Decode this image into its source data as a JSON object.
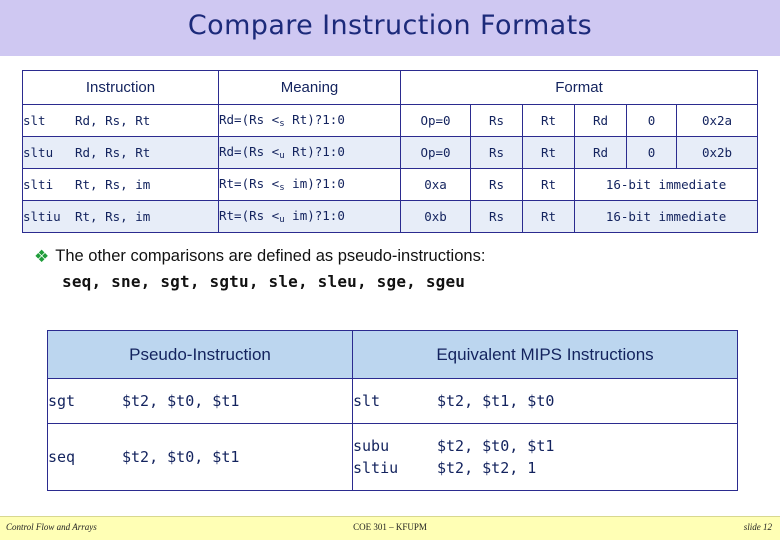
{
  "slide": {
    "title": "Compare Instruction Formats",
    "banner_color": "#cfc8f2",
    "title_color": "#1c2a7a"
  },
  "format_table": {
    "headers": {
      "instruction": "Instruction",
      "meaning": "Meaning",
      "format": "Format"
    },
    "rows": [
      {
        "name": "slt",
        "operands": "Rd, Rs, Rt",
        "meaning_pre": "Rd=(Rs <",
        "meaning_sub": "s",
        "meaning_post": " Rt)?1:0",
        "f1": "Op=0",
        "f2": "Rs",
        "f3": "Rt",
        "f4": "Rd",
        "f5": "0",
        "f6": "0x2a",
        "span_last": false
      },
      {
        "name": "sltu",
        "operands": "Rd, Rs, Rt",
        "meaning_pre": "Rd=(Rs <",
        "meaning_sub": "u",
        "meaning_post": " Rt)?1:0",
        "f1": "Op=0",
        "f2": "Rs",
        "f3": "Rt",
        "f4": "Rd",
        "f5": "0",
        "f6": "0x2b",
        "span_last": false
      },
      {
        "name": "slti",
        "operands": "Rt, Rs, im",
        "meaning_pre": "Rt=(Rs <",
        "meaning_sub": "s",
        "meaning_post": " im)?1:0",
        "f1": "0xa",
        "f2": "Rs",
        "f3": "Rt",
        "f4": "16-bit immediate",
        "f5": "",
        "f6": "",
        "span_last": true
      },
      {
        "name": "sltiu",
        "operands": "Rt, Rs, im",
        "meaning_pre": "Rt=(Rs <",
        "meaning_sub": "u",
        "meaning_post": " im)?1:0",
        "f1": "0xb",
        "f2": "Rs",
        "f3": "Rt",
        "f4": "16-bit immediate",
        "f5": "",
        "f6": "",
        "span_last": true
      }
    ]
  },
  "bullet": {
    "marker": "❖",
    "text": "The other comparisons are defined as pseudo-instructions:",
    "pseudo_list": "seq, sne, sgt, sgtu, sle, sleu, sge, sgeu"
  },
  "pseudo_table": {
    "headers": {
      "left": "Pseudo-Instruction",
      "right": "Equivalent MIPS Instructions"
    },
    "rows": [
      {
        "pseudo_op": "sgt",
        "pseudo_args": "$t2, $t0, $t1",
        "equiv": [
          {
            "op": "slt",
            "args": "$t2, $t1, $t0"
          }
        ]
      },
      {
        "pseudo_op": "seq",
        "pseudo_args": "$t2, $t0, $t1",
        "equiv": [
          {
            "op": "subu",
            "args": "$t2, $t0, $t1"
          },
          {
            "op": "sltiu",
            "args": "$t2, $t2, 1"
          }
        ]
      }
    ]
  },
  "footer": {
    "left": "Control Flow and Arrays",
    "center": "COE 301 – KFUPM",
    "right": "slide 12"
  }
}
